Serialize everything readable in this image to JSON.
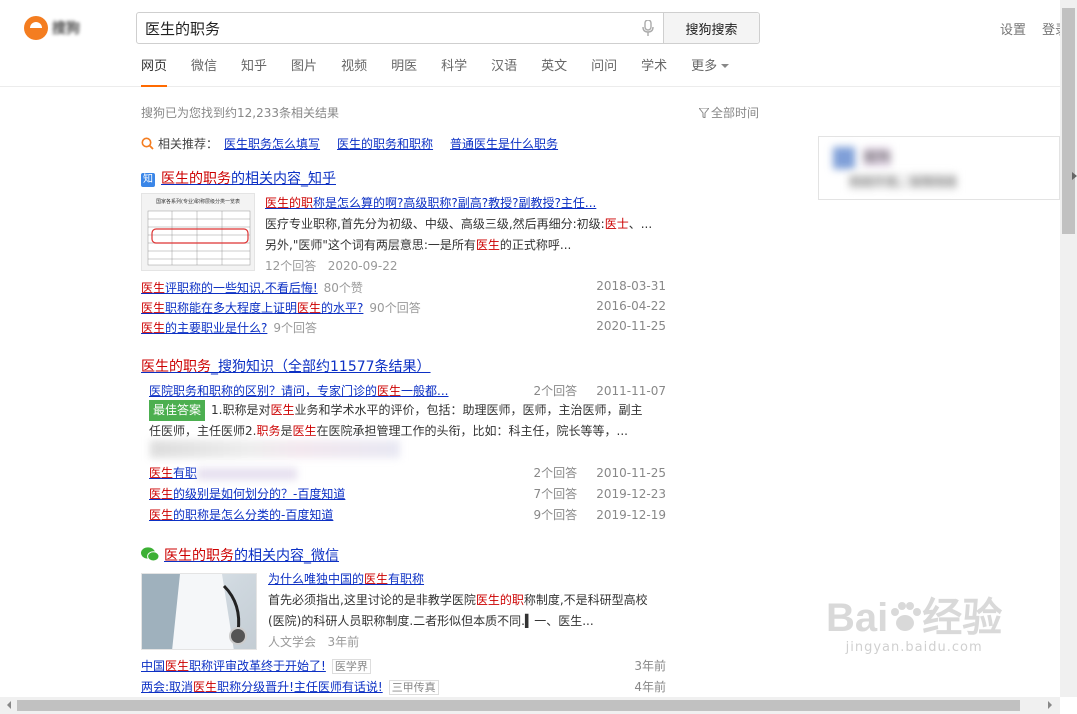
{
  "logo_text": "搜狗",
  "search": {
    "value": "医生的职务",
    "button": "搜狗搜索"
  },
  "top_links": [
    "设置",
    "登录"
  ],
  "nav": {
    "items": [
      "网页",
      "微信",
      "知乎",
      "图片",
      "视频",
      "明医",
      "科学",
      "汉语",
      "英文",
      "问问",
      "学术"
    ],
    "more": "更多",
    "active": "网页"
  },
  "result_count": "搜狗已为您找到约12,233条相关结果",
  "time_filter": "全部时间",
  "related": {
    "label": "相关推荐：",
    "links": [
      "医生职务怎么填写",
      "医生的职务和职称",
      "普通医生是什么职务"
    ]
  },
  "zhihu_block": {
    "badge": "知",
    "title_hl": "医生的职务",
    "title_rest": "的相关内容_知乎",
    "thumb_caption": "国家各系列(专业)职称层级分类一览表",
    "item_title_pre": "医生",
    "item_title_mid": "的职",
    "item_title_rest": "称是怎么算的啊?高级职称?副高?教授?副教授?主任...",
    "desc1_pre": "医疗专业职称,首先分为初级、中级、高级三级,然后再细分:初级:",
    "desc1_hl": "医士",
    "desc1_post": "、...",
    "desc2_pre": "另外,\"医师\"这个词有两层意思:一是所有",
    "desc2_hl": "医生",
    "desc2_post": "的正式称呼...",
    "meta_answers": "12个回答",
    "meta_date": "2020-09-22",
    "rows": [
      {
        "hl": "医生",
        "text": "评职称的一些知识,不看后悔!",
        "count": "80个赞",
        "date": "2018-03-31"
      },
      {
        "hl": "医生",
        "text": "职称能在多大程度上证明",
        "hl2": "医生",
        "text2": "的水平?",
        "count": "90个回答",
        "date": "2016-04-22"
      },
      {
        "hl": "医生",
        "text": "的主要职业是什么?",
        "count": "9个回答",
        "date": "2020-11-25"
      }
    ]
  },
  "zhishi_block": {
    "title_hl": "医生的职务",
    "title_rest": "_搜狗知识（全部约11577条结果）",
    "first_title_pre": "医院职务和职称的区别？请问，专家门诊的",
    "first_title_hl": "医生",
    "first_title_post": "一般都...",
    "first_count": "2个回答",
    "first_date": "2011-11-07",
    "best_label": "最佳答案",
    "best_l1_a": "1.职称是对",
    "best_l1_hl": "医生",
    "best_l1_b": "业务和学术水平的评价，包括：助理医师，医师，主治医师，副主",
    "best_l2_a": "任医师，主任医师2.",
    "best_l2_hl": "职务",
    "best_l2_b": "是",
    "best_l2_hl2": "医生",
    "best_l2_c": "在医院承担管理工作的头衔，比如：科主任，院长等等，...",
    "rows": [
      {
        "hl": "医生",
        "text": "有职",
        "count": "2个回答",
        "date": "2010-11-25"
      },
      {
        "hl": "医生",
        "text": "的级别是如何划分的？-百度知道",
        "count": "7个回答",
        "date": "2019-12-23"
      },
      {
        "hl": "医生",
        "text": "的职称是怎么分类的-百度知道",
        "count": "9个回答",
        "date": "2019-12-19"
      }
    ]
  },
  "weixin_block": {
    "title_hl": "医生的职务",
    "title_rest": "的相关内容_微信",
    "item_title_pre": "为什么唯独中国的",
    "item_title_hl": "医生",
    "item_title_post": "有职称",
    "desc1_pre": "首先必须指出,这里讨论的是非教学医院",
    "desc1_hl": "医生的职",
    "desc1_post": "称制度,不是科研型高校",
    "desc2": "(医院)的科研人员职称制度.二者形似但本质不同.▍一、医生...",
    "source": "人文学会",
    "time": "3年前",
    "rows": [
      {
        "pre": "中国",
        "hl": "医生",
        "text": "职称评审改革终于开始了!",
        "tag": "医学界",
        "date": "3年前"
      },
      {
        "pre": "两会:取消",
        "hl": "医生",
        "text": "职称分级晋升!主任医师有话说!",
        "tag": "三甲传真",
        "date": "4年前"
      }
    ]
  },
  "right_card": {
    "title": "搜狗",
    "subtitle": "网络环境，保障网络"
  },
  "watermark": {
    "brand": "Bai",
    "brand2": "经验",
    "url": "jingyan.baidu.com"
  },
  "colors": {
    "accent": "#ff6a00",
    "link": "#0c30c4",
    "highlight": "#cc0000"
  }
}
